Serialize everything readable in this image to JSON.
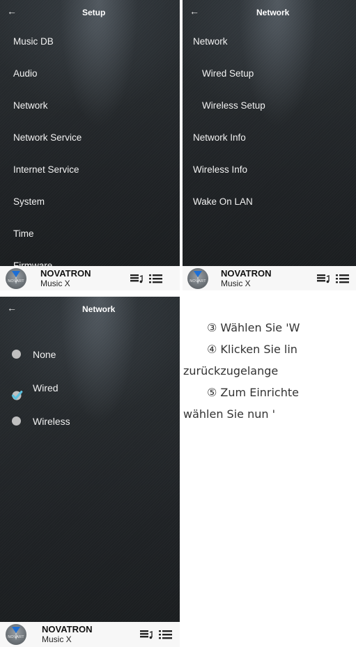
{
  "screens": [
    {
      "title": "Setup",
      "back_icon": "arrow-left-icon",
      "items": [
        "Music DB",
        "Audio",
        "Network",
        "Network Service",
        "Internet Service",
        "System",
        "Time",
        "Firmware"
      ],
      "bottom_bar": {
        "brand": "NOVATRON",
        "subtitle": "Music X",
        "logo_text": "NOVART"
      }
    },
    {
      "title": "Network",
      "back_icon": "arrow-left-icon",
      "items": [
        "Network",
        "Wired Setup",
        "Wireless Setup",
        "Network Info",
        "Wireless Info",
        "Wake On LAN"
      ],
      "bottom_bar": {
        "brand": "NOVATRON",
        "subtitle": "Music X",
        "logo_text": "NOVART"
      }
    },
    {
      "title": "Network",
      "back_icon": "arrow-left-icon",
      "options": [
        {
          "label": "None",
          "selected": false
        },
        {
          "label": "Wired",
          "selected": true
        },
        {
          "label": "Wireless",
          "selected": false
        }
      ],
      "bottom_bar": {
        "brand": "NOVATRON",
        "subtitle": "Music X",
        "logo_text": "NOVART"
      }
    }
  ],
  "instructions": [
    "③ Wählen Sie 'W",
    "④ Klicken Sie lin",
    "zurückzugelange",
    "⑤ Zum Einrichte",
    "wählen Sie nun '"
  ],
  "colors": {
    "screen_bg": "#25292c",
    "text_light": "#f2f2f2",
    "check_color": "#5bc0de",
    "bottom_bar_bg": "#f7f7f7"
  },
  "icons": [
    "arrow-left-icon",
    "music-library-icon",
    "menu-list-icon",
    "check-icon",
    "radio-dot-icon",
    "novart-logo-icon"
  ]
}
